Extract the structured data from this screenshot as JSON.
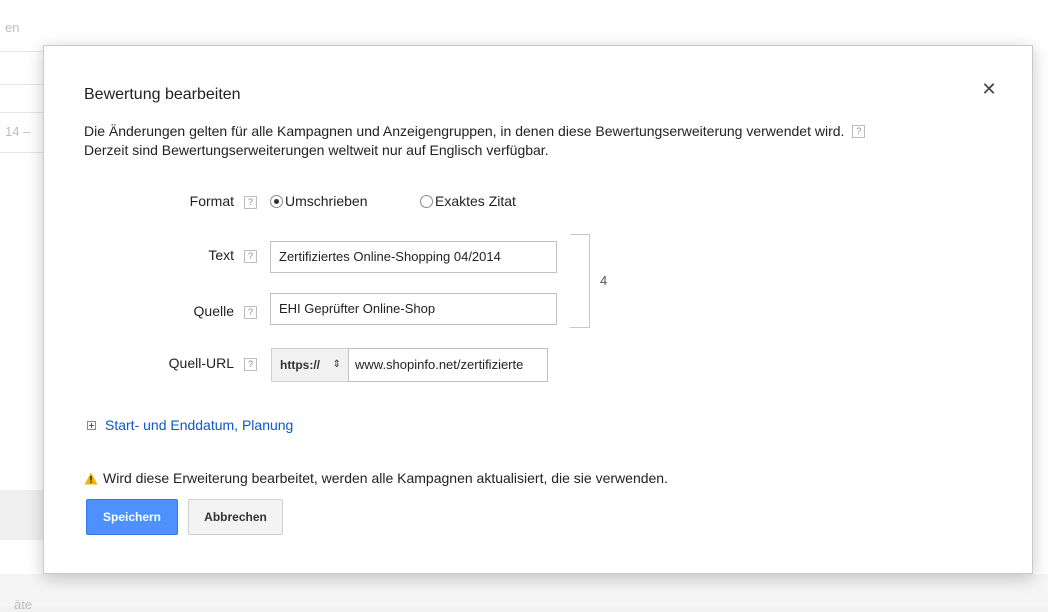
{
  "background": {
    "fragment_top": "en",
    "fragment_mid": "14 –",
    "fragment_bottom": "äte"
  },
  "modal": {
    "title": "Bewertung bearbeiten",
    "close_symbol": "✕",
    "description_line1": "Die Änderungen gelten für alle Kampagnen und Anzeigengruppen, in denen diese Bewertungserweiterung verwendet wird.",
    "description_line2": "Derzeit sind Bewertungserweiterungen weltweit nur auf Englisch verfügbar.",
    "help_symbol": "?"
  },
  "form": {
    "format_label": "Format",
    "format_options": [
      {
        "label": "Umschrieben",
        "selected": true
      },
      {
        "label": "Exaktes Zitat",
        "selected": false
      }
    ],
    "text_label": "Text",
    "text_value": "Zertifiziertes Online-Shopping 04/2014",
    "source_label": "Quelle",
    "source_value": "EHI Geprüfter Online-Shop",
    "counter": "4",
    "url_label": "Quell-URL",
    "protocol_value": "https://",
    "protocol_arrows": "⇕",
    "url_value": "www.shopinfo.net/zertifizierte"
  },
  "schedule": {
    "label": "Start- und Enddatum, Planung"
  },
  "warning": {
    "text": "Wird diese Erweiterung bearbeitet, werden alle Kampagnen aktualisiert, die sie verwenden.",
    "icon_color": "#f4b400"
  },
  "buttons": {
    "save": "Speichern",
    "cancel": "Abbrechen"
  },
  "colors": {
    "primary": "#4d90fe",
    "link": "#1155cc"
  }
}
